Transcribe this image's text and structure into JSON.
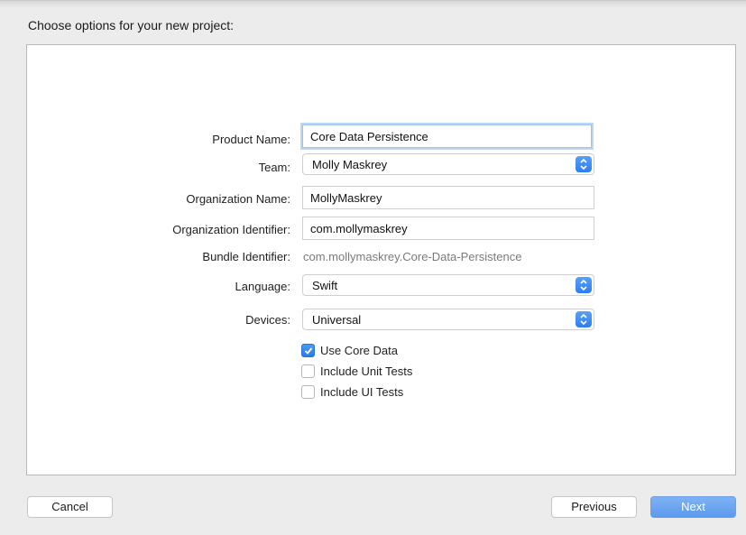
{
  "dialog": {
    "title": "Choose options for your new project:"
  },
  "form": {
    "product_name": {
      "label": "Product Name:",
      "value": "Core Data Persistence"
    },
    "team": {
      "label": "Team:",
      "value": "Molly Maskrey"
    },
    "organization_name": {
      "label": "Organization Name:",
      "value": "MollyMaskrey"
    },
    "organization_identifier": {
      "label": "Organization Identifier:",
      "value": "com.mollymaskrey"
    },
    "bundle_identifier": {
      "label": "Bundle Identifier:",
      "value": "com.mollymaskrey.Core-Data-Persistence"
    },
    "language": {
      "label": "Language:",
      "value": "Swift"
    },
    "devices": {
      "label": "Devices:",
      "value": "Universal"
    },
    "checkboxes": [
      {
        "label": "Use Core Data",
        "checked": true
      },
      {
        "label": "Include Unit Tests",
        "checked": false
      },
      {
        "label": "Include UI Tests",
        "checked": false
      }
    ]
  },
  "buttons": {
    "cancel": "Cancel",
    "previous": "Previous",
    "next": "Next"
  },
  "colors": {
    "accent": "#2c7ef0",
    "panel_bg": "#ffffff",
    "window_bg": "#ececec"
  }
}
